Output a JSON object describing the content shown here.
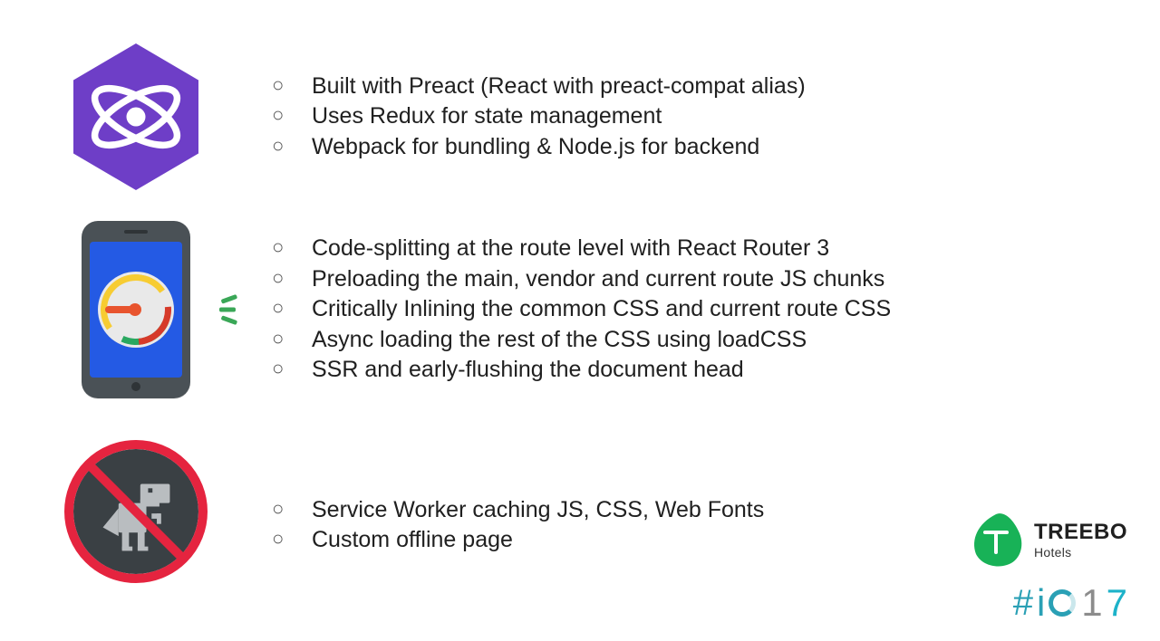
{
  "sections": [
    {
      "icon": "preact-logo",
      "items": [
        "Built with Preact (React with preact-compat alias)",
        "Uses Redux for state management",
        "Webpack for bundling & Node.js for backend"
      ]
    },
    {
      "icon": "lighthouse-phone",
      "items": [
        "Code-splitting at the route level with React Router 3",
        "Preloading the main, vendor and current route JS chunks",
        "Critically Inlining the common CSS and current route CSS",
        "Async loading the rest of the CSS using loadCSS",
        "SSR and early-flushing the document head"
      ]
    },
    {
      "icon": "offline-dino-banned",
      "items": [
        "Service Worker caching JS, CSS, Web Fonts",
        "Custom offline page"
      ]
    }
  ],
  "logos": {
    "treebo": {
      "brand": "TREEBO",
      "sub": "Hotels"
    },
    "io17": {
      "text": "#io17"
    }
  }
}
